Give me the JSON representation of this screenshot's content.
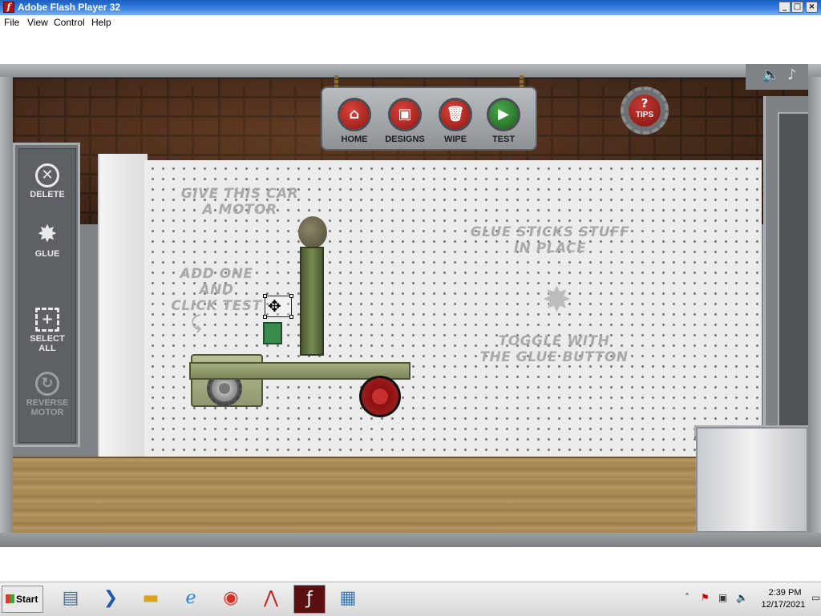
{
  "window": {
    "title": "Adobe Flash Player 32",
    "controls": {
      "minimize": "_",
      "maximize": "□",
      "close": "×"
    }
  },
  "menu": [
    "File",
    "View",
    "Control",
    "Help"
  ],
  "toolbar": {
    "home": "HOME",
    "designs": "DESIGNS",
    "wipe": "WIPE",
    "test": "TEST",
    "tips_symbol": "?",
    "tips": "TIPS"
  },
  "tools": {
    "delete": "DELETE",
    "glue": "GLUE",
    "select_all_line1": "SELECT",
    "select_all_line2": "ALL",
    "reverse_line1": "REVERSE",
    "reverse_line2": "MOTOR"
  },
  "hints": {
    "motor_line1": "GIVE THIS CAR",
    "motor_line2": "A MOTOR",
    "add_line1": "ADD ONE AND",
    "add_line2": "CLICK TEST",
    "glue_line1": "GLUE STICKS STUFF",
    "glue_line2": "IN PLACE",
    "toggle_line1": "TOGGLE WITH",
    "toggle_line2": "THE GLUE BUTTON"
  },
  "icons": {
    "delete": "close-circle-icon",
    "glue": "glue-splat-icon",
    "select_all": "select-all-icon",
    "reverse_motor": "reverse-arrow-icon",
    "sound": "speaker-icon",
    "music": "music-note-icon",
    "home": "house-icon",
    "designs": "floppy-disk-icon",
    "wipe": "trash-can-icon",
    "test": "play-icon"
  },
  "colors": {
    "button_red": "#b3221c",
    "test_green": "#2f8a2f",
    "pegboard": "#ececec",
    "panel_gray": "#6f7378"
  },
  "taskbar": {
    "start": "Start",
    "apps": [
      "server-manager-icon",
      "powershell-icon",
      "file-explorer-icon",
      "internet-explorer-icon",
      "chrome-icon",
      "acrobat-icon",
      "flash-player-icon",
      "network-icon"
    ],
    "clock_time": "2:39 PM",
    "clock_date": "12/17/2021"
  }
}
